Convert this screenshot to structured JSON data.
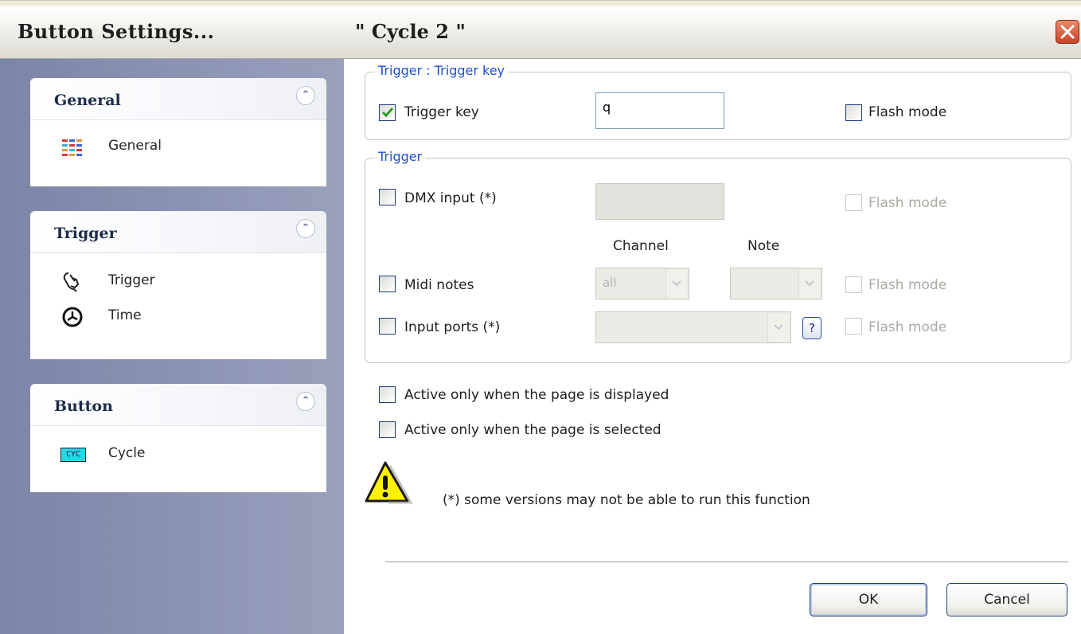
{
  "window": {
    "title_left": "Button  Settings...",
    "title_right": "\" Cycle 2 \""
  },
  "sidebar": {
    "groups": [
      {
        "title": "General",
        "items": [
          {
            "label": "General",
            "icon": "general-grid-icon"
          }
        ]
      },
      {
        "title": "Trigger",
        "items": [
          {
            "label": "Trigger",
            "icon": "hand-pointer-icon"
          },
          {
            "label": "Time",
            "icon": "clock-icon"
          }
        ]
      },
      {
        "title": "Button",
        "items": [
          {
            "label": "Cycle",
            "icon": "cyc-badge-icon",
            "badge": "CYC"
          }
        ]
      }
    ]
  },
  "trigger_key_group": {
    "legend": "Trigger : Trigger key",
    "trigger_key_label": "Trigger key",
    "trigger_key_checked": true,
    "trigger_key_value": "q",
    "flash_mode_label": "Flash mode",
    "flash_mode_checked": false
  },
  "trigger_group": {
    "legend": "Trigger",
    "dmx_input_label": "DMX input (*)",
    "dmx_flash_label": "Flash mode",
    "channel_header": "Channel",
    "note_header": "Note",
    "midi_notes_label": "Midi notes",
    "midi_channel_value": "all",
    "midi_note_value": "",
    "midi_flash_label": "Flash mode",
    "input_ports_label": "Input ports (*)",
    "input_ports_value": "",
    "help_label": "?",
    "input_flash_label": "Flash mode"
  },
  "options": {
    "active_displayed_label": "Active only when the page is displayed",
    "active_selected_label": "Active only when the page is selected"
  },
  "warning": {
    "text": "(*) some versions may not be able to run this function"
  },
  "buttons": {
    "ok": "OK",
    "cancel": "Cancel"
  },
  "colors": {
    "legend_blue": "#1e4fcf",
    "sidebar_bg": "#8a91b0",
    "close_red": "#c9452a"
  }
}
